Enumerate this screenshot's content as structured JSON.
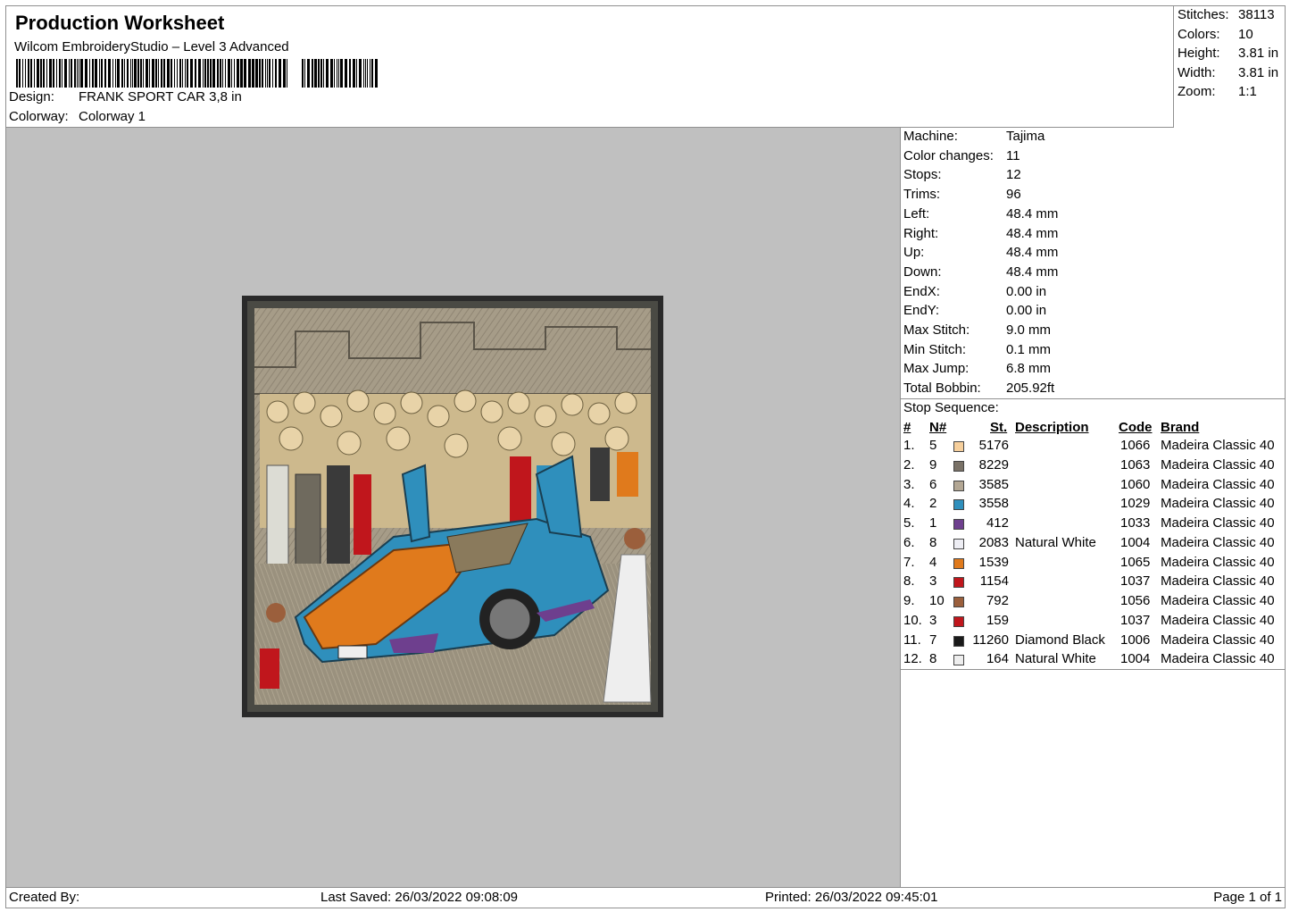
{
  "header": {
    "title": "Production Worksheet",
    "software": "Wilcom EmbroideryStudio – Level 3 Advanced",
    "design_label": "Design:",
    "design_value": "FRANK SPORT CAR 3,8 in",
    "colorway_label": "Colorway:",
    "colorway_value": "Colorway 1"
  },
  "summary": [
    {
      "label": "Stitches:",
      "value": "38113"
    },
    {
      "label": "Colors:",
      "value": "10"
    },
    {
      "label": "Height:",
      "value": "3.81 in"
    },
    {
      "label": "Width:",
      "value": "3.81 in"
    },
    {
      "label": "Zoom:",
      "value": "1:1"
    }
  ],
  "machine_info": [
    {
      "label": "Machine:",
      "value": "Tajima"
    },
    {
      "label": "Color changes:",
      "value": "11"
    },
    {
      "label": "Stops:",
      "value": "12"
    },
    {
      "label": "Trims:",
      "value": "96"
    },
    {
      "label": "Left:",
      "value": "48.4 mm"
    },
    {
      "label": "Right:",
      "value": "48.4 mm"
    },
    {
      "label": "Up:",
      "value": "48.4 mm"
    },
    {
      "label": "Down:",
      "value": "48.4 mm"
    },
    {
      "label": "EndX:",
      "value": "0.00 in"
    },
    {
      "label": "EndY:",
      "value": "0.00 in"
    },
    {
      "label": "Max Stitch:",
      "value": "9.0 mm"
    },
    {
      "label": "Min Stitch:",
      "value": "0.1 mm"
    },
    {
      "label": "Max Jump:",
      "value": "6.8 mm"
    },
    {
      "label": "Total Bobbin:",
      "value": "205.92ft"
    }
  ],
  "stop_sequence": {
    "title": "Stop Sequence:",
    "columns": {
      "idx": "#",
      "needle": "N#",
      "stitches": "St.",
      "description": "Description",
      "code": "Code",
      "brand": "Brand"
    },
    "rows": [
      {
        "idx": "1.",
        "needle": "5",
        "color": "#f6cf9c",
        "stitches": "5176",
        "description": "",
        "code": "1066",
        "brand": "Madeira Classic 40"
      },
      {
        "idx": "2.",
        "needle": "9",
        "color": "#7a7267",
        "stitches": "8229",
        "description": "",
        "code": "1063",
        "brand": "Madeira Classic 40"
      },
      {
        "idx": "3.",
        "needle": "6",
        "color": "#b3a794",
        "stitches": "3585",
        "description": "",
        "code": "1060",
        "brand": "Madeira Classic 40"
      },
      {
        "idx": "4.",
        "needle": "2",
        "color": "#2f8fbc",
        "stitches": "3558",
        "description": "",
        "code": "1029",
        "brand": "Madeira Classic 40"
      },
      {
        "idx": "5.",
        "needle": "1",
        "color": "#6e3f8e",
        "stitches": "412",
        "description": "",
        "code": "1033",
        "brand": "Madeira Classic 40"
      },
      {
        "idx": "6.",
        "needle": "8",
        "color": "#eeeef4",
        "stitches": "2083",
        "description": "Natural White",
        "code": "1004",
        "brand": "Madeira Classic 40"
      },
      {
        "idx": "7.",
        "needle": "4",
        "color": "#e07a1c",
        "stitches": "1539",
        "description": "",
        "code": "1065",
        "brand": "Madeira Classic 40"
      },
      {
        "idx": "8.",
        "needle": "3",
        "color": "#c0161c",
        "stitches": "1154",
        "description": "",
        "code": "1037",
        "brand": "Madeira Classic 40"
      },
      {
        "idx": "9.",
        "needle": "10",
        "color": "#9b5f3c",
        "stitches": "792",
        "description": "",
        "code": "1056",
        "brand": "Madeira Classic 40"
      },
      {
        "idx": "10.",
        "needle": "3",
        "color": "#c0161c",
        "stitches": "159",
        "description": "",
        "code": "1037",
        "brand": "Madeira Classic 40"
      },
      {
        "idx": "11.",
        "needle": "7",
        "color": "#1a1a1a",
        "stitches": "11260",
        "description": "Diamond Black",
        "code": "1006",
        "brand": "Madeira Classic 40"
      },
      {
        "idx": "12.",
        "needle": "8",
        "color": "#eeeeee",
        "stitches": "164",
        "description": "Natural White",
        "code": "1004",
        "brand": "Madeira Classic 40"
      }
    ]
  },
  "footer": {
    "created_by": "Created By:",
    "last_saved": "Last Saved: 26/03/2022 09:08:09",
    "printed": "Printed: 26/03/2022 09:45:01",
    "page": "Page 1 of 1"
  }
}
